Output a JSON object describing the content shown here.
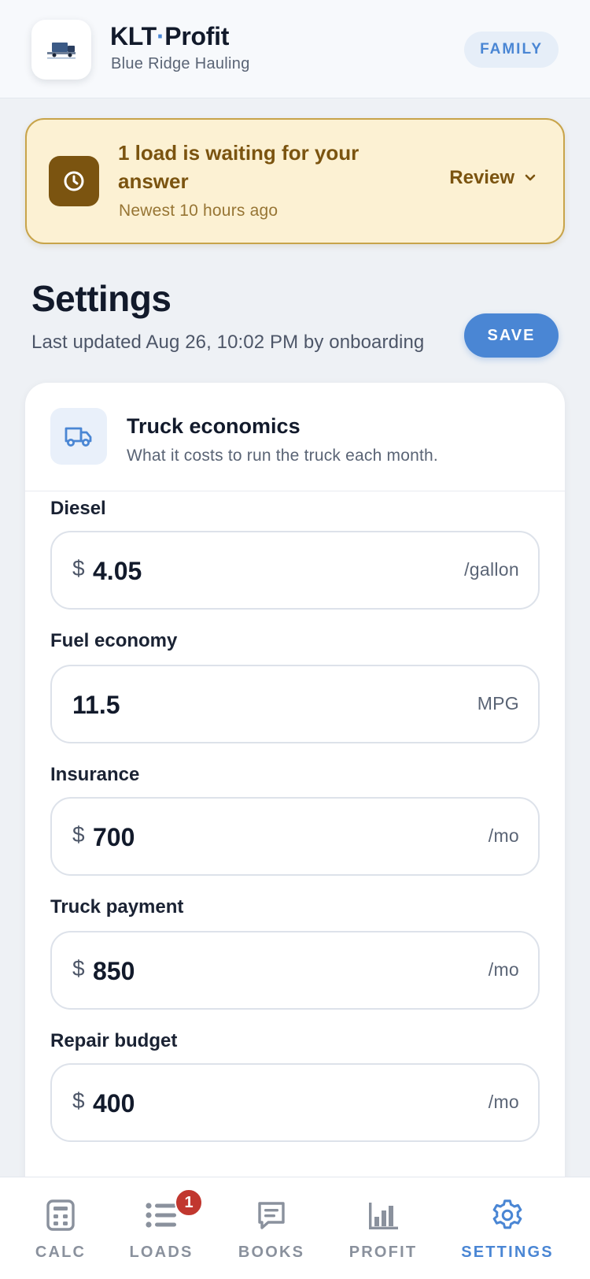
{
  "header": {
    "title_part1": "KLT",
    "title_dot": "·",
    "title_part2": "Profit",
    "subtitle": "Blue Ridge Hauling",
    "plan_badge": "FAMILY"
  },
  "alert": {
    "title": "1 load is waiting for your answer",
    "subtitle": "Newest 10 hours ago",
    "action_label": "Review"
  },
  "page": {
    "title": "Settings",
    "updated": "Last updated Aug 26, 10:02 PM by onboarding",
    "save_label": "SAVE"
  },
  "card": {
    "title": "Truck economics",
    "subtitle": "What it costs to run the truck each month.",
    "fields": [
      {
        "label": "Diesel",
        "prefix": "$",
        "value": "4.05",
        "suffix": "/gallon"
      },
      {
        "label": "Fuel economy",
        "prefix": "",
        "value": "11.5",
        "suffix": "MPG"
      },
      {
        "label": "Insurance",
        "prefix": "$",
        "value": "700",
        "suffix": "/mo"
      },
      {
        "label": "Truck payment",
        "prefix": "$",
        "value": "850",
        "suffix": "/mo"
      },
      {
        "label": "Repair budget",
        "prefix": "$",
        "value": "400",
        "suffix": "/mo"
      }
    ]
  },
  "tabs": [
    {
      "label": "CALC",
      "icon": "calculator-icon"
    },
    {
      "label": "LOADS",
      "icon": "list-icon",
      "badge": "1"
    },
    {
      "label": "BOOKS",
      "icon": "notebook-icon"
    },
    {
      "label": "PROFIT",
      "icon": "bar-chart-icon"
    },
    {
      "label": "SETTINGS",
      "icon": "gear-icon",
      "active": true
    }
  ],
  "colors": {
    "accent": "#4a86d4",
    "alert_bg": "#fcf1d3",
    "alert_text": "#7b5410",
    "badge": "#c1372f"
  }
}
